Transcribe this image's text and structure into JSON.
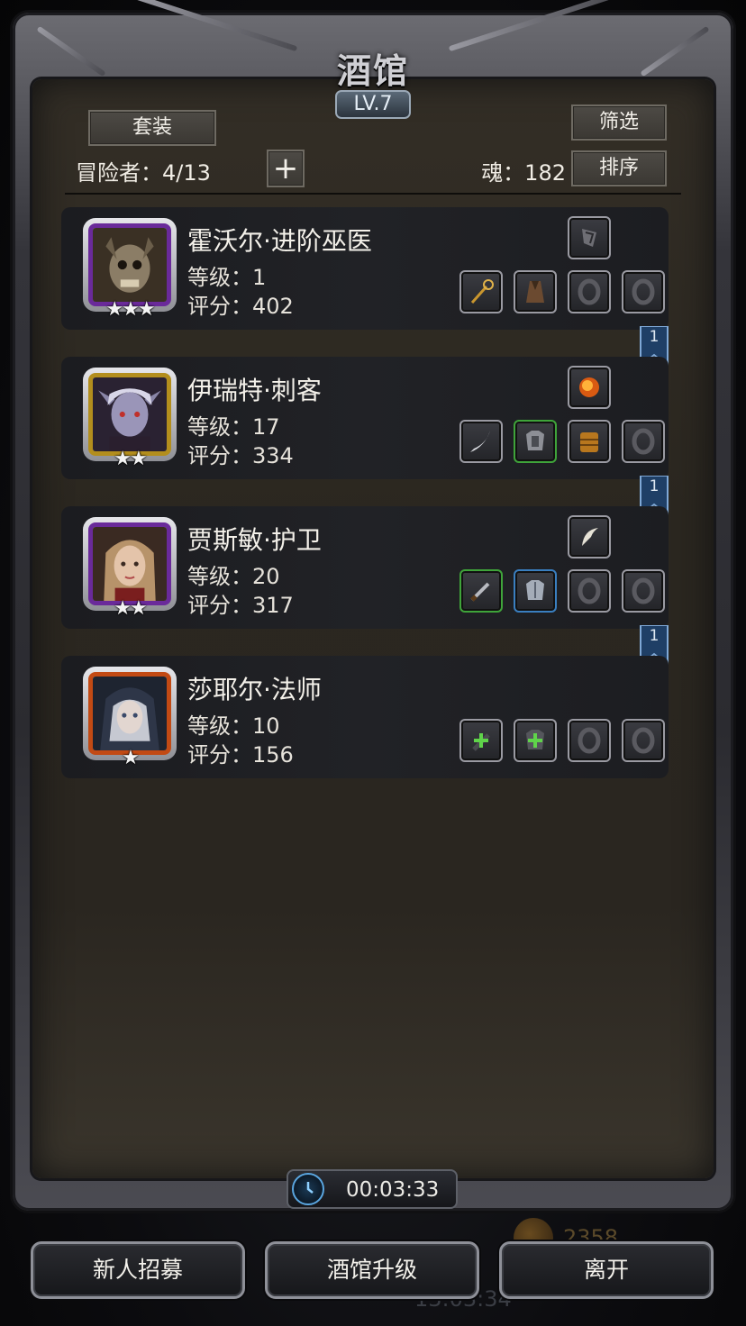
{
  "header": {
    "title": "酒馆",
    "level": "LV.7"
  },
  "toolbar": {
    "set_label": "套装",
    "filter_label": "筛选",
    "sort_label": "排序",
    "add_symbol": "+",
    "adventurers_label": "冒险者：4/13",
    "soul_label": "魂：182"
  },
  "heroes": [
    {
      "name": "霍沃尔·进阶巫医",
      "level": "等级：1",
      "score": "评分：402",
      "stars": "★★★",
      "frame": "purple",
      "bookmark": "1",
      "slots": [
        "talisman-icon",
        "staff-icon",
        "cloak-icon",
        "ring-empty-icon",
        "ring-empty-icon"
      ]
    },
    {
      "name": "伊瑞特·刺客",
      "level": "等级：17",
      "score": "评分：334",
      "stars": "★★",
      "frame": "gold",
      "bookmark": "1",
      "slots": [
        "fire-orb-icon",
        "curved-dagger-icon",
        "armor-icon",
        "chest-armor-icon",
        "ring-empty-icon"
      ]
    },
    {
      "name": "贾斯敏·护卫",
      "level": "等级：20",
      "score": "评分：317",
      "stars": "★★",
      "frame": "purple",
      "bookmark": "1",
      "slots": [
        "feather-icon",
        "greatsword-icon",
        "plate-armor-icon",
        "ring-empty-icon",
        "ring-empty-icon"
      ]
    },
    {
      "name": "莎耶尔·法师",
      "level": "等级：10",
      "score": "评分：156",
      "stars": "★",
      "frame": "orange",
      "slots": [
        "add-weapon-icon",
        "add-armor-icon",
        "ring-empty-icon",
        "ring-empty-icon"
      ]
    }
  ],
  "timer": {
    "value": "00:03:33"
  },
  "actions": {
    "recruit_label": "新人招募",
    "upgrade_label": "酒馆升级",
    "leave_label": "离开"
  },
  "colors": {
    "frame_purple": "#6a2a9a",
    "frame_gold": "#b38e1d",
    "frame_orange": "#c24a14",
    "slot_green": "#3fa43a",
    "slot_blue": "#3a7fc0"
  }
}
